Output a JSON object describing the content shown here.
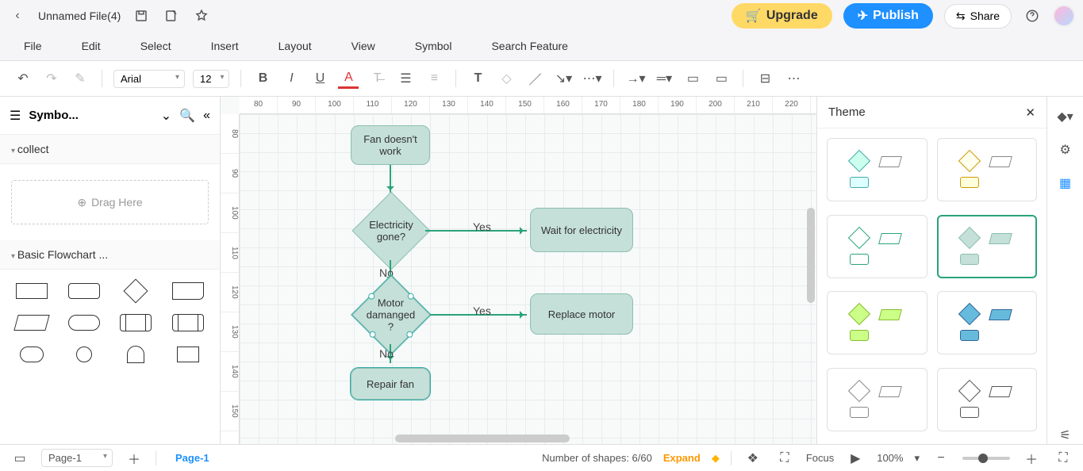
{
  "header": {
    "file_title": "Unnamed File(4)",
    "upgrade": "Upgrade",
    "publish": "Publish",
    "share": "Share"
  },
  "menu": {
    "file": "File",
    "edit": "Edit",
    "select": "Select",
    "insert": "Insert",
    "layout": "Layout",
    "view": "View",
    "symbol": "Symbol",
    "search": "Search Feature"
  },
  "toolbar": {
    "font": "Arial",
    "size": "12"
  },
  "left": {
    "title": "Symbo...",
    "sect1": "collect",
    "drag": "Drag Here",
    "sect2": "Basic Flowchart ..."
  },
  "canvas": {
    "ruler_h": [
      "80",
      "90",
      "100",
      "110",
      "120",
      "130",
      "140",
      "150",
      "160",
      "170",
      "180",
      "190",
      "200",
      "210",
      "220"
    ],
    "ruler_v": [
      "80",
      "90",
      "100",
      "110",
      "120",
      "130",
      "140",
      "150"
    ],
    "nodes": {
      "start": "Fan doesn't work",
      "d1": "Electricity gone?",
      "r1": "Wait for electricity",
      "d2": "Motor damanged ?",
      "r2": "Replace motor",
      "end": "Repair fan"
    },
    "labels": {
      "yes": "Yes",
      "no": "No"
    }
  },
  "theme": {
    "title": "Theme"
  },
  "status": {
    "page_sel": "Page-1",
    "page_tab": "Page-1",
    "shapes": "Number of shapes: 6/60",
    "expand": "Expand",
    "focus": "Focus",
    "zoom": "100%"
  }
}
